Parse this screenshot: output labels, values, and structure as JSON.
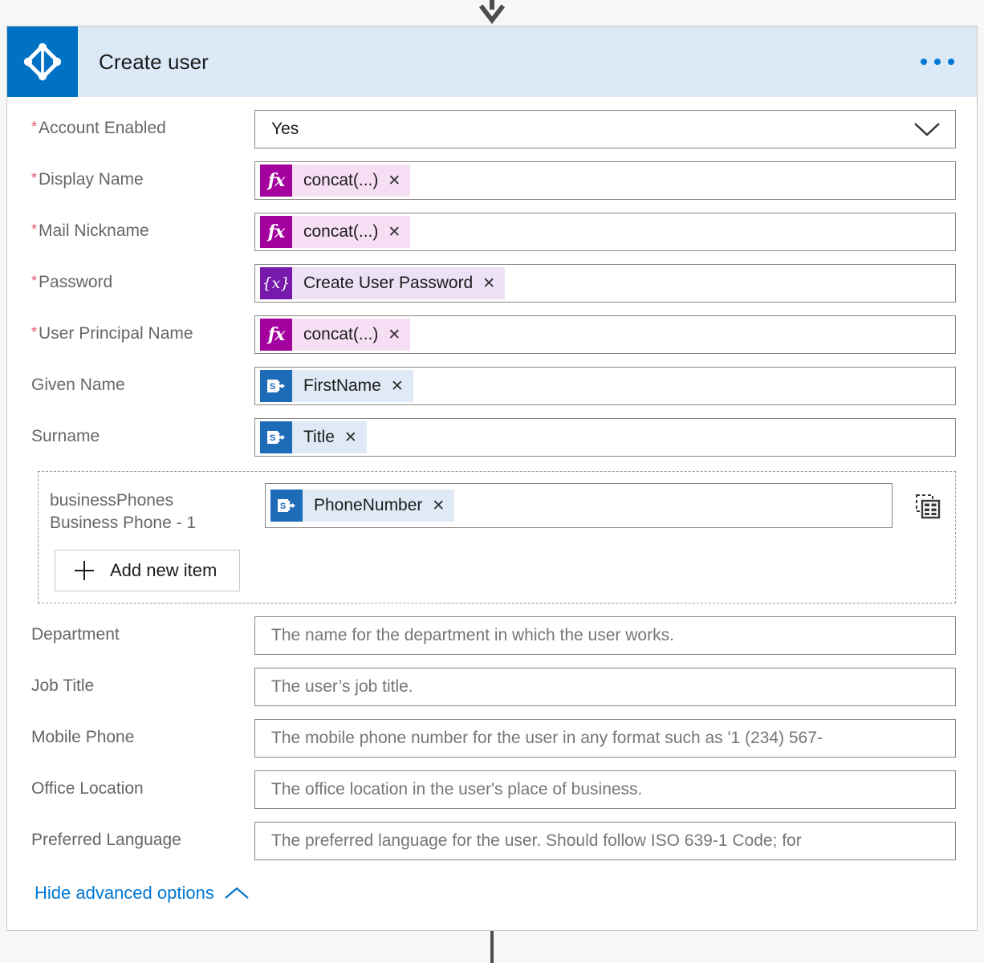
{
  "connector": {
    "top_arrow_icon": "arrow-down-icon",
    "bottom_line_icon": "connector-line"
  },
  "card": {
    "icon": "azure-active-directory-icon",
    "title": "Create user",
    "menu_icon": "ellipsis-horizontal-icon",
    "header_bg": "#dce9f7",
    "icon_bg": "#0072c6",
    "menu_dot_color": "#0078d4"
  },
  "colors": {
    "required_asterisk": "#e8526e",
    "link": "#0078d4",
    "function_token_icon": "#a4009e",
    "function_token_body": "#f6dff4",
    "variable_token_icon": "#7719aa",
    "variable_token_body": "#ece1f7",
    "sharepoint_token_icon": "#1e6bb8",
    "sharepoint_token_body": "#dfeaf6"
  },
  "fields": [
    {
      "label": "Account Enabled",
      "required": true,
      "control": "dropdown",
      "value": "Yes",
      "chevron_icon": "chevron-down-icon"
    },
    {
      "label": "Display Name",
      "required": true,
      "control": "token",
      "token": {
        "kind": "function",
        "icon": "fx-icon",
        "glyph": "fx",
        "text": "concat(...)",
        "remove_icon": "close-icon"
      }
    },
    {
      "label": "Mail Nickname",
      "required": true,
      "control": "token",
      "token": {
        "kind": "function",
        "icon": "fx-icon",
        "glyph": "fx",
        "text": "concat(...)",
        "remove_icon": "close-icon"
      }
    },
    {
      "label": "Password",
      "required": true,
      "control": "token",
      "token": {
        "kind": "variable",
        "icon": "variable-icon",
        "glyph": "{x}",
        "text": "Create User Password",
        "remove_icon": "close-icon"
      }
    },
    {
      "label": "User Principal Name",
      "required": true,
      "control": "token",
      "token": {
        "kind": "function",
        "icon": "fx-icon",
        "glyph": "fx",
        "text": "concat(...)",
        "remove_icon": "close-icon"
      }
    },
    {
      "label": "Given Name",
      "required": false,
      "control": "token",
      "token": {
        "kind": "sharepoint",
        "icon": "sharepoint-icon",
        "glyph": "S",
        "text": "FirstName",
        "remove_icon": "close-icon"
      }
    },
    {
      "label": "Surname",
      "required": false,
      "control": "token",
      "token": {
        "kind": "sharepoint",
        "icon": "sharepoint-icon",
        "glyph": "S",
        "text": "Title",
        "remove_icon": "close-icon"
      }
    }
  ],
  "array_field": {
    "label_line1": "businessPhones",
    "label_line2": "Business Phone - 1",
    "token": {
      "kind": "sharepoint",
      "icon": "sharepoint-icon",
      "glyph": "S",
      "text": "PhoneNumber",
      "remove_icon": "close-icon"
    },
    "switch_view_icon": "switch-to-array-view-icon",
    "add_button_label": "Add new item",
    "add_button_icon": "plus-icon"
  },
  "advanced_fields": [
    {
      "label": "Department",
      "placeholder": "The name for the department in which the user works."
    },
    {
      "label": "Job Title",
      "placeholder": "The user’s job title."
    },
    {
      "label": "Mobile Phone",
      "placeholder": "The mobile phone number for the user in any format such as '1 (234) 567-"
    },
    {
      "label": "Office Location",
      "placeholder": "The office location in the user's place of business."
    },
    {
      "label": "Preferred Language",
      "placeholder": "The preferred language for the user. Should follow ISO 639-1 Code; for"
    }
  ],
  "footer": {
    "hide_advanced_label": "Hide advanced options",
    "chevron_icon": "chevron-up-icon"
  }
}
